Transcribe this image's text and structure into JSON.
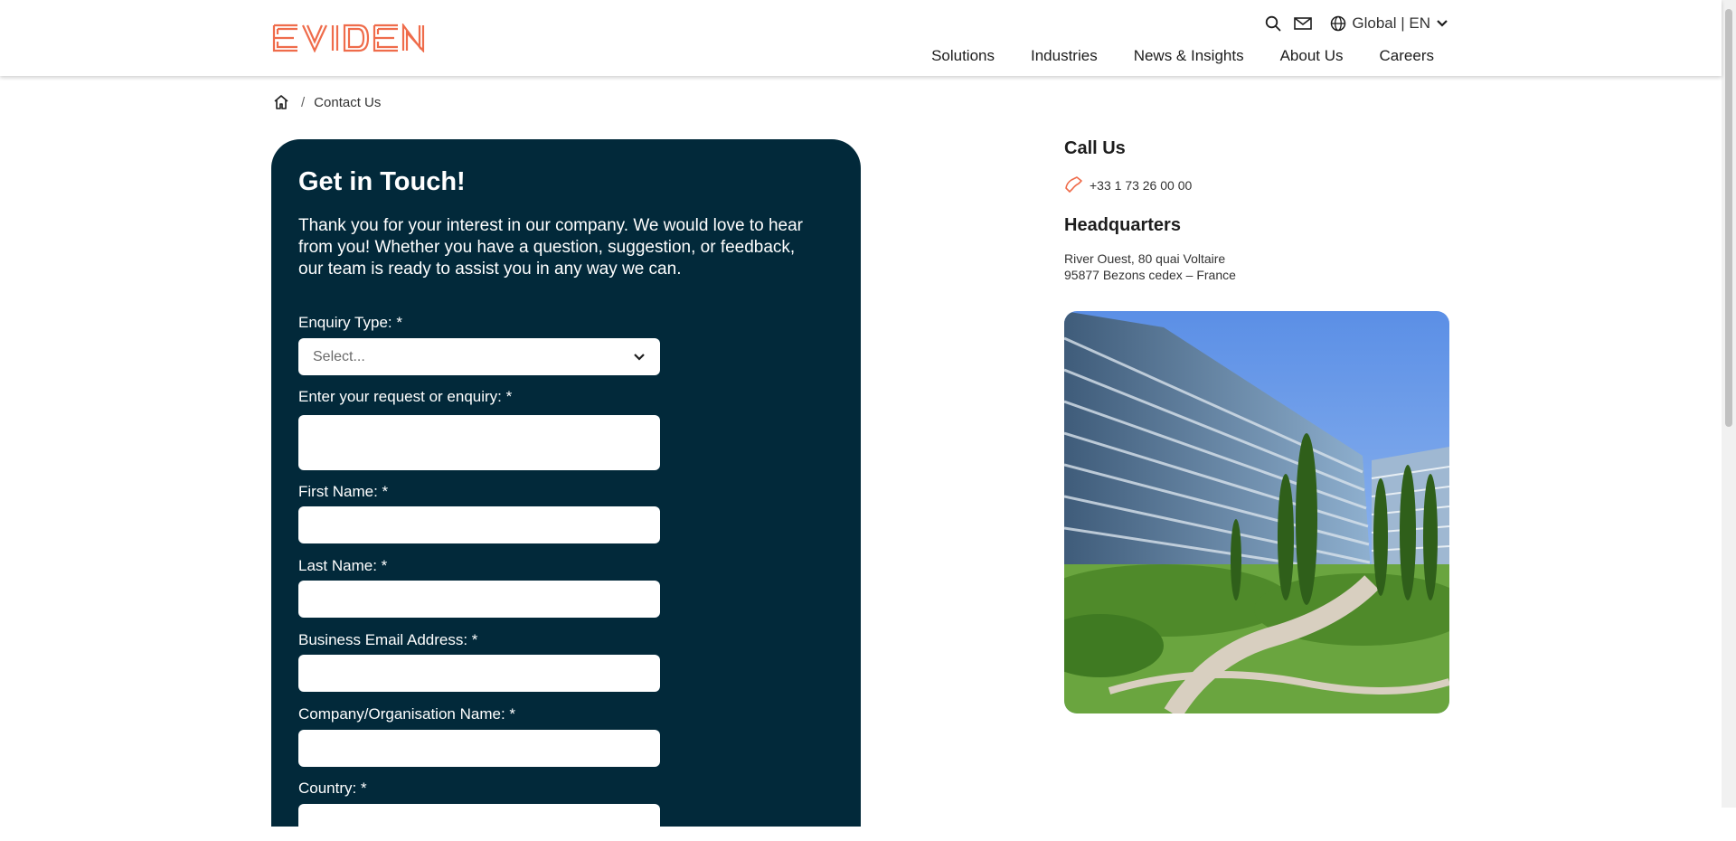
{
  "brand": {
    "logo_text": "EVIDEN",
    "accent_color": "#ef6c4b",
    "card_color": "#02293a"
  },
  "header": {
    "lang_label": "Global | EN",
    "nav": [
      "Solutions",
      "Industries",
      "News & Insights",
      "About Us",
      "Careers"
    ]
  },
  "breadcrumb": {
    "current": "Contact Us",
    "separator": "/"
  },
  "form": {
    "title": "Get in Touch!",
    "intro": "Thank you for your interest in our company. We would love to hear from you! Whether you have a question, suggestion, or feedback, our team is ready to assist you in any way we can.",
    "enquiry_label": "Enquiry Type: *",
    "enquiry_placeholder": "Select...",
    "request_label": "Enter your request or enquiry: *",
    "first_name_label": "First Name: *",
    "last_name_label": "Last Name: *",
    "email_label": "Business Email Address: *",
    "company_label": "Company/Organisation Name: *",
    "country_label": "Country: *"
  },
  "contact": {
    "call_heading": "Call Us",
    "phone": "+33 1 73 26 00 00",
    "hq_heading": "Headquarters",
    "address_line1": "River Ouest, 80 quai Voltaire",
    "address_line2": "95877 Bezons cedex – France"
  },
  "icons": [
    "search-icon",
    "mail-icon",
    "globe-icon",
    "chevron-down-icon",
    "home-icon",
    "phone-icon"
  ]
}
